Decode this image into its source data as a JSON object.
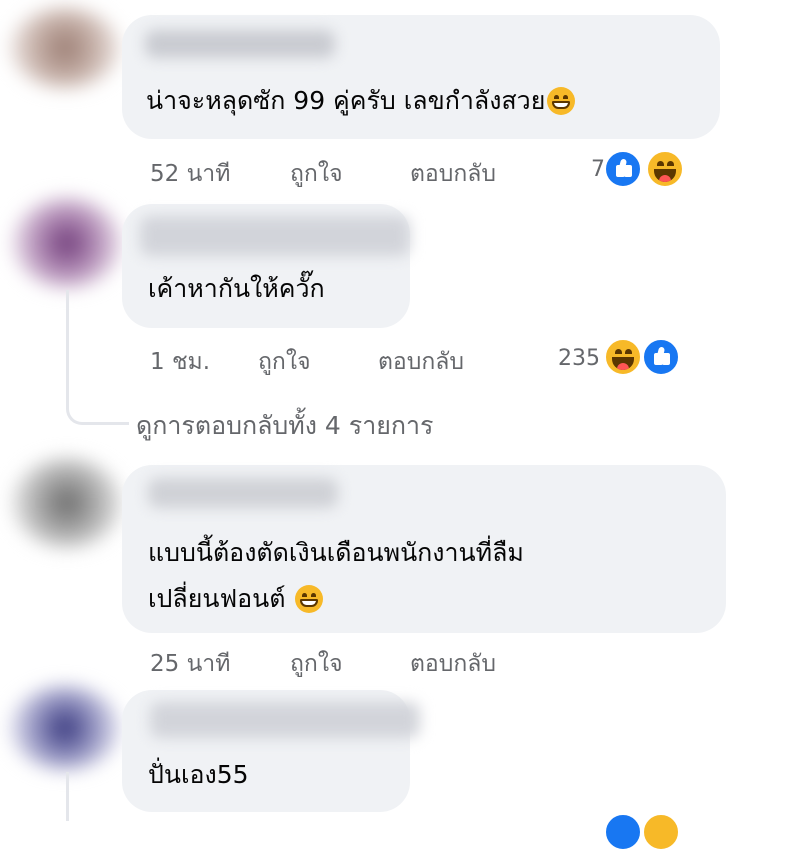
{
  "comments": [
    {
      "text": "น่าจะหลุดซัก 99 คู่ครับ เลขกำลังสวย",
      "time": "52 นาที",
      "like_label": "ถูกใจ",
      "reply_label": "ตอบกลับ",
      "reaction_count": "7",
      "reactions": [
        "like-icon",
        "haha-icon"
      ]
    },
    {
      "text": "เค้าหากันให้ควั๊ก",
      "time": "1 ชม.",
      "like_label": "ถูกใจ",
      "reply_label": "ตอบกลับ",
      "reaction_count": "235",
      "reactions": [
        "haha-icon",
        "like-icon"
      ],
      "view_replies": "ดูการตอบกลับทั้ง 4 รายการ"
    },
    {
      "text_line1": "แบบนี้ต้องตัดเงินเดือนพนักงานที่ลืม",
      "text_line2": "เปลี่ยนฟอนต์",
      "time": "25 นาที",
      "like_label": "ถูกใจ",
      "reply_label": "ตอบกลับ"
    },
    {
      "text": "ปั่นเอง55"
    }
  ],
  "colors": {
    "bubble": "#f0f2f5",
    "meta_text": "#65676b",
    "like_blue": "#1877f2",
    "emoji_yellow": "#f7b928"
  }
}
